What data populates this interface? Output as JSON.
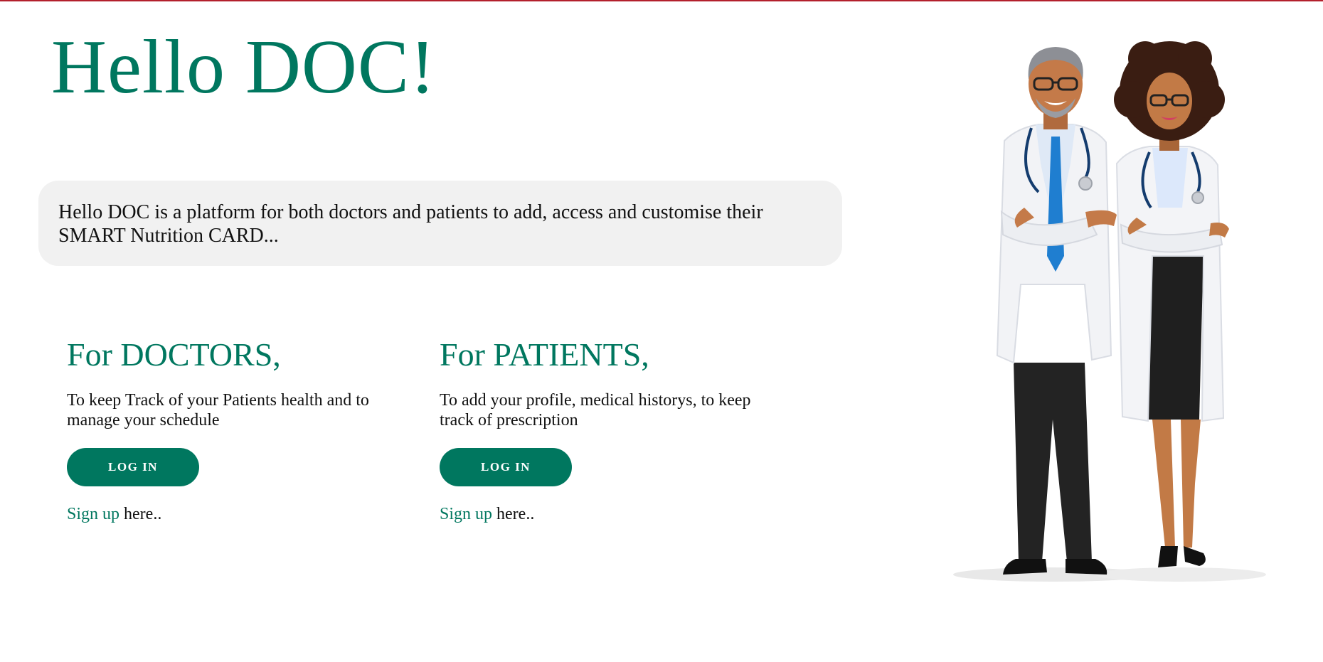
{
  "header": {
    "title": "Hello DOC!"
  },
  "intro": {
    "text": "Hello DOC is a platform for both doctors and patients to add, access and customise their SMART Nutrition CARD..."
  },
  "doctors": {
    "heading": "For DOCTORS,",
    "description": "To keep Track of your Patients health and to manage your schedule",
    "login_label": "LOG IN",
    "signup_link": "Sign up",
    "signup_suffix": " here.."
  },
  "patients": {
    "heading": "For PATIENTS,",
    "description": "To add your profile, medical historys, to keep track of prescription",
    "login_label": "LOG IN",
    "signup_link": "Sign up",
    "signup_suffix": " here.."
  },
  "colors": {
    "accent": "#00775f",
    "top_bar": "#b3202c",
    "intro_bg": "#f1f1f1"
  },
  "illustration": {
    "icon": "doctors-illustration"
  }
}
